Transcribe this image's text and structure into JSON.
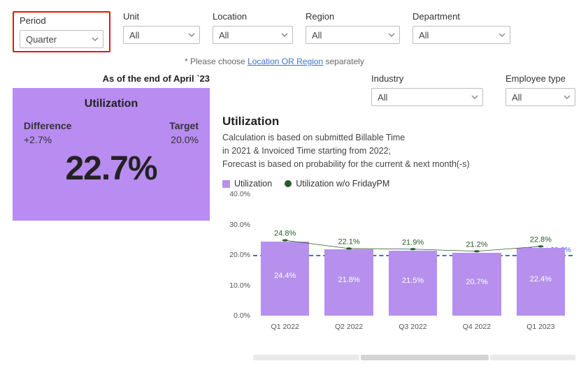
{
  "filters": {
    "period": {
      "label": "Period",
      "value": "Quarter"
    },
    "unit": {
      "label": "Unit",
      "value": "All"
    },
    "location": {
      "label": "Location",
      "value": "All"
    },
    "region": {
      "label": "Region",
      "value": "All"
    },
    "department": {
      "label": "Department",
      "value": "All"
    },
    "industry": {
      "label": "Industry",
      "value": "All"
    },
    "emptype": {
      "label": "Employee type",
      "value": "All"
    }
  },
  "note": {
    "prefix": "* Please choose ",
    "link": "Location OR Region",
    "suffix": " separately"
  },
  "asof": "As of the end of April `23",
  "card": {
    "title": "Utilization",
    "difference_label": "Difference",
    "difference_value": "+2.7%",
    "target_label": "Target",
    "target_value": "20.0%",
    "main_value": "22.7%"
  },
  "section": {
    "title": "Utilization",
    "desc1": "Calculation is based on submitted Billable Time",
    "desc2": "in 2021 & Invoiced Time starting from 2022;",
    "desc3": "Forecast is based on probability for the current & next month(-s)"
  },
  "legend": {
    "a": "Utilization",
    "b": "Utilization w/o FridayPM"
  },
  "chart_data": {
    "type": "bar",
    "categories": [
      "Q1 2022",
      "Q2 2022",
      "Q3 2022",
      "Q4 2022",
      "Q1 2023"
    ],
    "series": [
      {
        "name": "Utilization",
        "style": "bar",
        "values": [
          24.4,
          21.8,
          21.5,
          20.7,
          22.4
        ]
      },
      {
        "name": "Utilization w/o FridayPM",
        "style": "line",
        "values": [
          24.8,
          22.1,
          21.9,
          21.2,
          22.8
        ]
      }
    ],
    "target": {
      "label": "Target 20.0%",
      "value": 20.0
    },
    "ylabel": "",
    "xlabel": "",
    "yticks": [
      "0.0%",
      "10.0%",
      "20.0%",
      "30.0%",
      "40.0%"
    ],
    "ylim": [
      0,
      40
    ]
  }
}
